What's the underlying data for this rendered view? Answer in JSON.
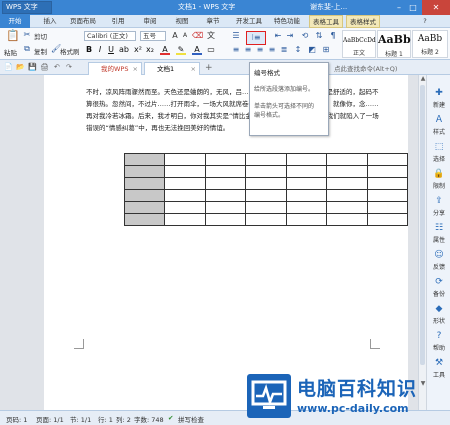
{
  "titlebar": {
    "app_logo": "WPS 文字",
    "doc_title": "文档1 - WPS 文字",
    "user": "谢东斐-上...",
    "help_mark": "?"
  },
  "menu_tabs": [
    "开始",
    "插入",
    "页面布局",
    "引用",
    "审阅",
    "视图",
    "章节",
    "开发工具",
    "特色功能",
    "表格工具",
    "表格样式"
  ],
  "ribbon": {
    "paste": "粘贴",
    "cut": "剪切",
    "copy": "复制",
    "format_painter": "格式刷",
    "font_name": "Calibri (正文)",
    "font_size": "五号",
    "styles": [
      {
        "sample": "AaBbCcDd",
        "label": "正文"
      },
      {
        "sample": "AaBb",
        "label": "标题 1"
      },
      {
        "sample": "AaBb",
        "label": "标题 2"
      }
    ]
  },
  "tooltip": {
    "title": "编号格式",
    "lines": [
      "给所选段落添加编号。",
      "单击箭头可选择不同的",
      "编号格式。"
    ]
  },
  "doc_tabs": {
    "tab1": "我的WPS",
    "tab2": "文档1",
    "right_hint": "点此查找命令(Alt+Q)"
  },
  "document": {
    "paragraph": "不时，凉风阵雨骤然而至。天色还是蛐朗的，无风，吕……鸟语花香的校园里，还算是舒适的，起码不算很热。忽然间，不过片……打开雨伞，一场大风就席卷全校，一场大雨就骤然而至。就像你，念……再对我冷若冰霜。后来，我才明白，你对我其实是“情比金坚”的，只是后来的后来，我们就陷入了一场错误的“情感纠葛”中，再也无法挽回美好的情谊。",
    "table_rows": 6,
    "table_cols": 7
  },
  "sidebar": [
    {
      "icon": "new-icon",
      "label": "新建"
    },
    {
      "icon": "style-icon",
      "label": "样式"
    },
    {
      "icon": "select-icon",
      "label": "选择"
    },
    {
      "icon": "restrict-icon",
      "label": "限制"
    },
    {
      "icon": "share-icon",
      "label": "分享"
    },
    {
      "icon": "property-icon",
      "label": "属性"
    },
    {
      "icon": "feedback-icon",
      "label": "反馈"
    },
    {
      "icon": "backup-icon",
      "label": "备份"
    },
    {
      "icon": "shape-icon",
      "label": "形状"
    },
    {
      "icon": "help-icon",
      "label": "帮助"
    },
    {
      "icon": "tools-icon",
      "label": "工具"
    }
  ],
  "statusbar": {
    "page": "页码: 1",
    "pages": "页面: 1/1",
    "section": "节: 1/1",
    "row": "行: 1",
    "col": "列: 2",
    "words": "字数: 748",
    "spellcheck": "拼写检查"
  },
  "watermark": {
    "brand": "电脑百科知识",
    "url": "www.pc-daily.com"
  },
  "colors": {
    "title_blue": "#3a85d3",
    "highlight_red": "#e02020",
    "watermark_blue": "#1b64b8"
  }
}
